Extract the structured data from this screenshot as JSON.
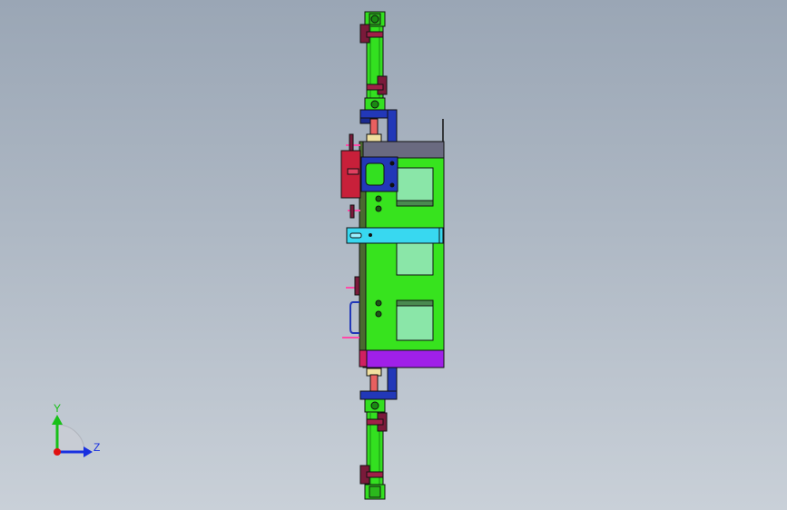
{
  "viewport": {
    "background_top": "#9aa6b5",
    "background_bottom": "#c9d0d8"
  },
  "model": {
    "colors": {
      "cylinder_green": "#33e020",
      "plate_green": "#37e31e",
      "bracket_blue": "#2238b8",
      "slider_cyan": "#38d8f0",
      "block_red": "#c8203a",
      "plate_purple": "#a020e8",
      "window_green": "#8ae6a8",
      "clamp_dark": "#7a1a3a",
      "bolt_pink": "#ff4aa8",
      "edge_black": "#111111",
      "top_plate_gray": "#6a6a80"
    }
  },
  "triad": {
    "y_label": "Y",
    "z_label": "Z",
    "y_color": "#18c018",
    "z_color": "#1830e0",
    "origin_color": "#e01010"
  }
}
